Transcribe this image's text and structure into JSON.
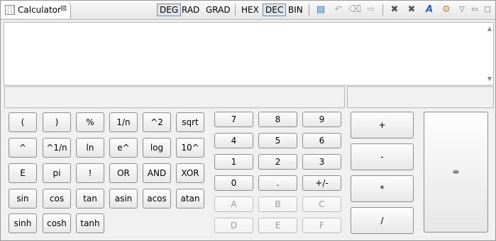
{
  "window": {
    "title": "Calculator",
    "close_glyph": "⊠"
  },
  "toolbar": {
    "angle_modes": [
      "DEG",
      "RAD",
      "GRAD"
    ],
    "active_angle": "DEG",
    "bases": [
      "HEX",
      "DEC",
      "BIN"
    ],
    "active_base": "DEC",
    "icons": [
      "memory-icon",
      "undo-icon",
      "clear-icon",
      "export-icon",
      "delete-icon",
      "delete-all-icon",
      "font-icon",
      "settings-icon",
      "view-menu-icon",
      "minimize-icon",
      "maximize-icon"
    ],
    "icon_glyphs": {
      "memory-icon": "▤",
      "undo-icon": "↶",
      "clear-icon": "⌫",
      "export-icon": "⇨",
      "delete-icon": "✖",
      "delete-all-icon": "✖",
      "font-icon": "A",
      "settings-icon": "⚙",
      "view-menu-icon": "▽",
      "minimize-icon": "▭",
      "maximize-icon": "□"
    }
  },
  "display": {
    "expression": "",
    "result": "",
    "status_left": "",
    "status_right": ""
  },
  "keypad": {
    "functions": [
      [
        "(",
        ")",
        "%",
        "1/n",
        "^2",
        "sqrt"
      ],
      [
        "^",
        "^1/n",
        "ln",
        "e^",
        "log",
        "10^"
      ],
      [
        "E",
        "pi",
        "!",
        "OR",
        "AND",
        "XOR"
      ],
      [
        "sin",
        "cos",
        "tan",
        "asin",
        "acos",
        "atan"
      ],
      [
        "sinh",
        "cosh",
        "tanh"
      ]
    ],
    "digits": [
      [
        "7",
        "8",
        "9"
      ],
      [
        "4",
        "5",
        "6"
      ],
      [
        "1",
        "2",
        "3"
      ],
      [
        "0",
        ".",
        "+/-"
      ],
      [
        "A",
        "B",
        "C"
      ],
      [
        "D",
        "E",
        "F"
      ]
    ],
    "disabled_digits": [
      "A",
      "B",
      "C",
      "D",
      "E",
      "F"
    ],
    "operators": [
      "+",
      "-",
      "*",
      "/"
    ],
    "equals": "="
  }
}
